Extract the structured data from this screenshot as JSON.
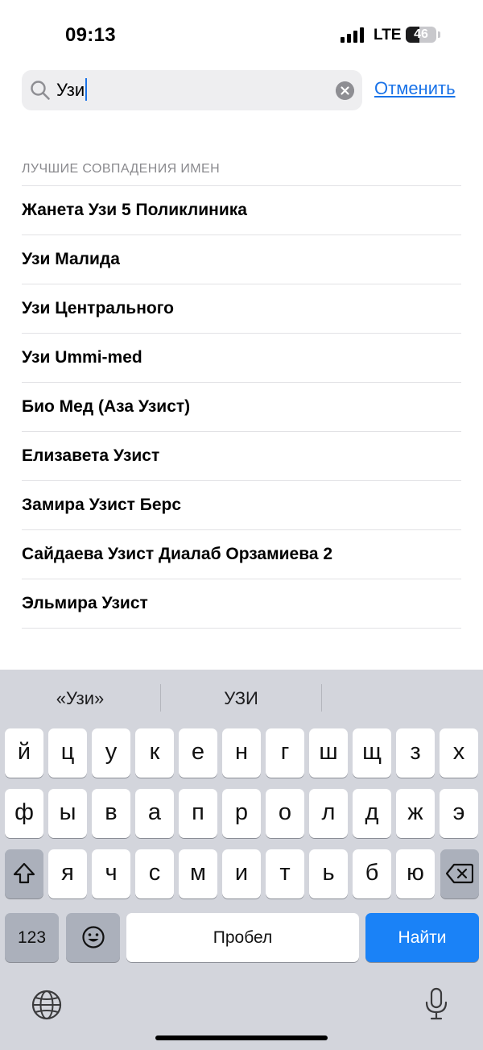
{
  "status": {
    "time": "09:13",
    "network": "LTE",
    "battery": "46",
    "battery_level": 0.46
  },
  "search": {
    "query": "Узи",
    "cancel_label": "Отменить"
  },
  "results": {
    "section_title": "ЛУЧШИЕ СОВПАДЕНИЯ ИМЕН",
    "items": [
      "Жанета Узи 5 Поликлиника",
      "Узи Малида",
      "Узи Центрального",
      "Узи Ummi-med",
      "Био Мед (Аза Узист)",
      "Елизавета Узист",
      "Замира Узист Берс",
      "Сайдаева Узист Диалаб Орзамиева 2",
      "Эльмира Узист"
    ]
  },
  "keyboard": {
    "suggestions": [
      "«Узи»",
      "УЗИ",
      ""
    ],
    "row1": [
      "й",
      "ц",
      "у",
      "к",
      "е",
      "н",
      "г",
      "ш",
      "щ",
      "з",
      "х"
    ],
    "row2": [
      "ф",
      "ы",
      "в",
      "а",
      "п",
      "р",
      "о",
      "л",
      "д",
      "ж",
      "э"
    ],
    "row3": [
      "я",
      "ч",
      "с",
      "м",
      "и",
      "т",
      "ь",
      "б",
      "ю"
    ],
    "numbers_label": "123",
    "space_label": "Пробел",
    "go_label": "Найти"
  },
  "icons": {
    "signal": "cellular-signal-icon",
    "search": "magnifier-icon",
    "clear": "clear-x-icon",
    "shift": "shift-arrow-icon",
    "delete": "backspace-icon",
    "emoji": "emoji-face-icon",
    "globe": "globe-icon",
    "mic": "microphone-icon"
  },
  "colors": {
    "accent": "#1a73e8",
    "go_key": "#1a82f7"
  }
}
